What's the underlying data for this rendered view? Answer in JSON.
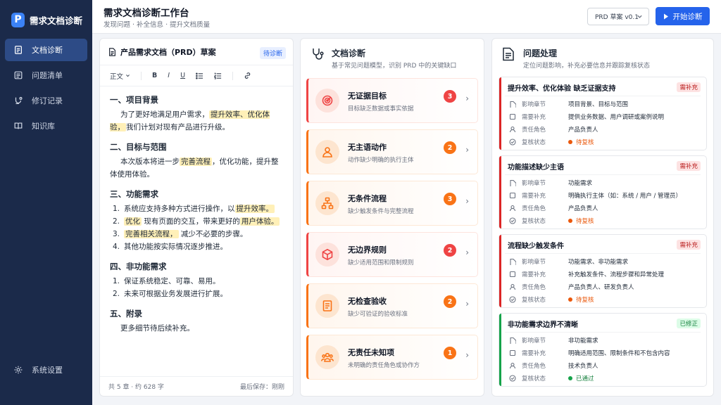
{
  "brand": {
    "name": "需求文档诊断",
    "logo_letter": "P"
  },
  "nav": {
    "items": [
      {
        "label": "文档诊断",
        "icon": "document-icon",
        "active": true
      },
      {
        "label": "问题清单",
        "icon": "list-icon",
        "active": false
      },
      {
        "label": "修订记录",
        "icon": "history-icon",
        "active": false
      },
      {
        "label": "知识库",
        "icon": "book-icon",
        "active": false
      }
    ],
    "settings_label": "系统设置"
  },
  "header": {
    "title": "需求文档诊断工作台",
    "subtitle": "发现问题 · 补全信息 · 提升文档质量",
    "version": "PRD 草案 v0.1",
    "start_label": "开始诊断"
  },
  "doc": {
    "title": "产品需求文档（PRD）草案",
    "status": "待诊断",
    "toolbar": {
      "style": "正文",
      "bold": "B",
      "italic": "I",
      "underline": "U"
    },
    "footer_left": "共 5 章  ·  约 628 字",
    "footer_right": "最后保存：刚刚",
    "s1": {
      "h": "一、项目背景",
      "p1": "为了更好地满足用户需求，",
      "hl1": "提升效率、优化体验，",
      "p2": "我们计划对现有产品进行升级。"
    },
    "s2": {
      "h": "二、目标与范围",
      "p1": "本次版本将进一步",
      "hl1": "完善流程",
      "p2": "，优化功能，提升整体使用体验。"
    },
    "s3": {
      "h": "三、功能需求",
      "i1a": "系统应支持多种方式进行操作，以",
      "i1hl": "提升效率。",
      "i2hl1": "优化",
      "i2a": "现有页面的交互，带来更好的",
      "i2hl2": "用户体验。",
      "i3hl": "完善相关流程，",
      "i3a": "减少不必要的步骤。",
      "i4a": "其他功能按实际情况逐步推进。"
    },
    "s4": {
      "h": "四、非功能需求",
      "i1": "保证系统稳定、可靠、易用。",
      "i2": "未来可根据业务发展进行扩展。"
    },
    "s5": {
      "h": "五、附录",
      "p1": "更多细节待后续补充。"
    }
  },
  "diagnosis": {
    "title": "文档诊断",
    "subtitle": "基于常见问题模型，识别 PRD 中的关键缺口",
    "items": [
      {
        "name": "无证据目标",
        "desc": "目标缺乏数据或事实依据",
        "count": "3",
        "level": "red",
        "icon": "target-icon"
      },
      {
        "name": "无主语动作",
        "desc": "动作缺少明确的执行主体",
        "count": "2",
        "level": "orange",
        "icon": "user-icon"
      },
      {
        "name": "无条件流程",
        "desc": "缺少触发条件与完整流程",
        "count": "3",
        "level": "orange",
        "icon": "flow-icon"
      },
      {
        "name": "无边界规则",
        "desc": "缺少适用范围和限制规则",
        "count": "2",
        "level": "red",
        "icon": "cube-icon"
      },
      {
        "name": "无检查验收",
        "desc": "缺少可验证的验收标准",
        "count": "2",
        "level": "orange",
        "icon": "checklist-icon"
      },
      {
        "name": "无责任未知项",
        "desc": "未明确的责任角色或协作方",
        "count": "1",
        "level": "orange",
        "icon": "team-icon"
      }
    ],
    "colors": {
      "red": "#ef4444",
      "orange": "#f97316"
    }
  },
  "issues": {
    "title": "问题处理",
    "subtitle": "定位问题影响，补充必要信息并跟踪复核状态",
    "labels": {
      "chapter": "影响章节",
      "supplement": "需要补充",
      "role": "责任角色",
      "review": "复核状态"
    },
    "items": [
      {
        "title": "提升效率、优化体验 缺乏证据支持",
        "tag": "需补充",
        "done": false,
        "chapter": "项目背景、目标与范围",
        "supplement": "提供业务数据、用户调研或案例说明",
        "role": "产品负责人",
        "review": "待复核"
      },
      {
        "title": "功能描述缺少主语",
        "tag": "需补充",
        "done": false,
        "chapter": "功能需求",
        "supplement": "明确执行主体（如：系统 / 用户 / 管理员）",
        "role": "产品负责人",
        "review": "待复核"
      },
      {
        "title": "流程缺少触发条件",
        "tag": "需补充",
        "done": false,
        "chapter": "功能需求、非功能需求",
        "supplement": "补充触发条件、流程步骤和异常处理",
        "role": "产品负责人、研发负责人",
        "review": "待复核"
      },
      {
        "title": "非功能需求边界不清晰",
        "tag": "已修正",
        "done": true,
        "chapter": "非功能需求",
        "supplement": "明确适用范围、限制条件和不包含内容",
        "role": "技术负责人",
        "review": "已通过"
      }
    ]
  }
}
